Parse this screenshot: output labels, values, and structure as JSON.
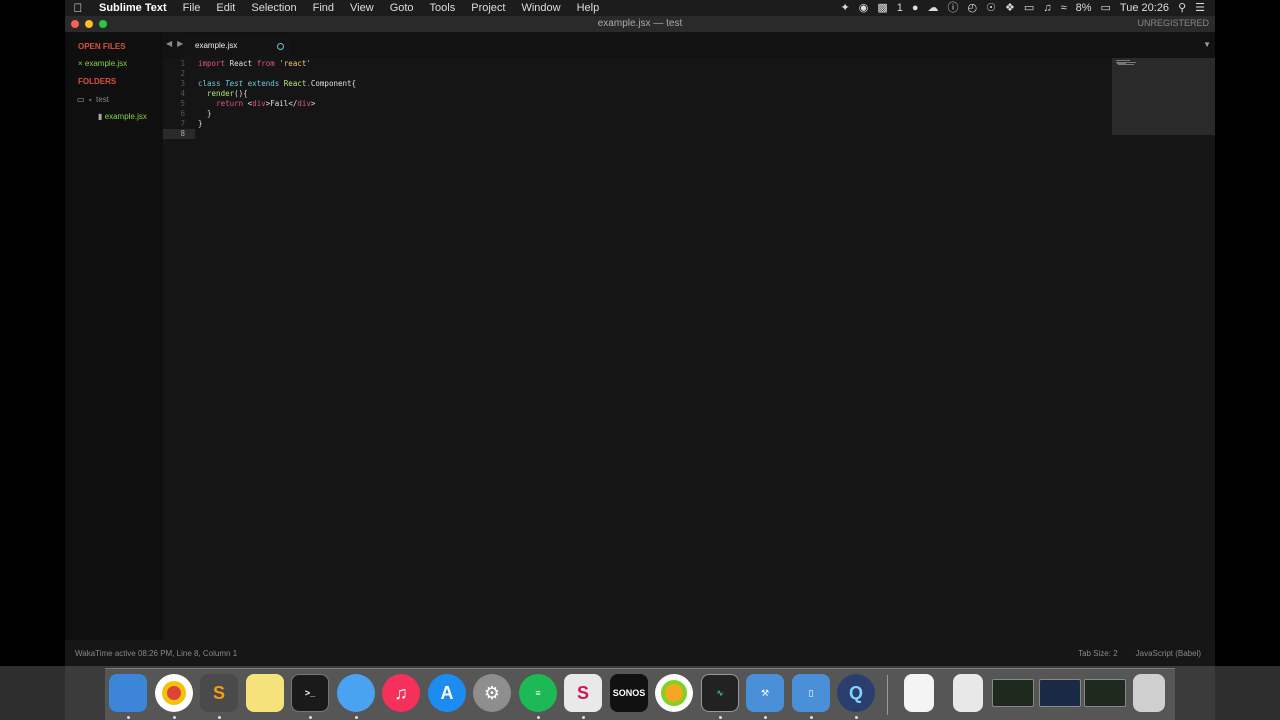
{
  "menubar": {
    "app_name": "Sublime Text",
    "menus": [
      "File",
      "Edit",
      "Selection",
      "Find",
      "View",
      "Goto",
      "Tools",
      "Project",
      "Window",
      "Help"
    ],
    "notification_count": "1",
    "battery": "8%",
    "clock": "Tue 20:26"
  },
  "window": {
    "title": "example.jsx — test",
    "registration": "UNREGISTERED"
  },
  "sidebar": {
    "open_files_header": "OPEN FILES",
    "open_files": [
      "example.jsx"
    ],
    "folders_header": "FOLDERS",
    "folder_name": "test",
    "folder_files": [
      "example.jsx"
    ]
  },
  "tabs": [
    {
      "label": "example.jsx",
      "dirty": true
    }
  ],
  "editor": {
    "line_numbers": [
      "1",
      "2",
      "3",
      "4",
      "5",
      "6",
      "7",
      "8"
    ],
    "current_line": 8
  },
  "statusbar": {
    "left": "WakaTime active 08:26 PM, Line 8, Column 1",
    "tab_size": "Tab Size: 2",
    "syntax": "JavaScript (Babel)"
  },
  "code": {
    "l1": {
      "import": "import",
      "name": " React ",
      "from": "from",
      "str": " 'react'"
    },
    "l3": {
      "class": "class",
      "name": " Test",
      "extends": " extends",
      "react": " React",
      "dot": ".",
      "comp": "Component",
      "brace": "{"
    },
    "l4": {
      "indent": "  ",
      "method": "render",
      "rest": "(){"
    },
    "l5": {
      "indent": "    ",
      "ret": "return",
      "sp": " ",
      "lt": "<",
      "tag": "div",
      "gt": ">",
      "text": "Fail",
      "lt2": "</",
      "tag2": "div",
      "gt2": ">"
    },
    "l6": "  }",
    "l7": "}"
  },
  "dock": {
    "apps": [
      "finder",
      "chrome",
      "sublime-text",
      "notes",
      "terminal",
      "messages",
      "itunes",
      "app-store",
      "system-preferences",
      "spotify",
      "slack",
      "sonos",
      "photos",
      "activity-monitor",
      "xcode",
      "simulator",
      "quicktime",
      "document",
      "preview",
      "screenshot-1",
      "screenshot-2",
      "screenshot-3",
      "trash"
    ],
    "labels": {
      "sublime": "S",
      "terminal": ">_",
      "slack": "S",
      "sonos": "SONOS",
      "quicktime": "Q"
    }
  }
}
